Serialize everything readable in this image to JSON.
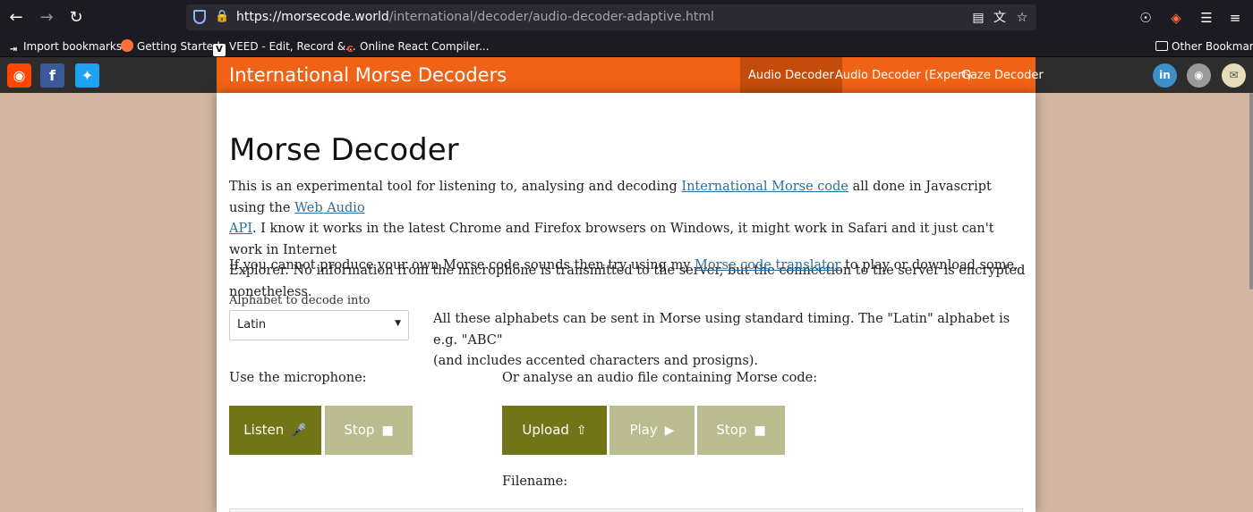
{
  "browser": {
    "url_host": "https://morsecode.world",
    "url_path": "/international/decoder/audio-decoder-adaptive.html",
    "bookmarks": [
      {
        "label": "Import bookmarks..."
      },
      {
        "label": "Getting Started"
      },
      {
        "label": "VEED - Edit, Record &..."
      },
      {
        "label": "Online React Compiler..."
      }
    ],
    "other_bookmarks": "Other Bookmarks",
    "icons": {
      "back": "arrow-left-icon",
      "forward": "arrow-right-icon",
      "reload": "reload-icon",
      "shield": "shield-icon",
      "lock": "lock-icon",
      "reader": "reader-view-icon",
      "translate": "translate-icon",
      "star": "star-icon",
      "pocket": "pocket-icon",
      "extension": "extensions-icon"
    }
  },
  "colors": {
    "accent": "#f06316",
    "accent_active": "#c44c0a",
    "button_dark": "#727517",
    "button_light": "#babb8e",
    "link": "#2c6e9e"
  },
  "site": {
    "title": "International Morse Decoders",
    "nav": [
      {
        "label": "Audio Decoder",
        "active": true
      },
      {
        "label": "Audio Decoder (Expert)",
        "active": false
      },
      {
        "label": "Gaze Decoder",
        "active": false
      }
    ],
    "social_left": [
      "reddit-icon",
      "facebook-icon",
      "twitter-icon"
    ],
    "social_right": [
      "linkedin-icon",
      "github-icon",
      "email-icon"
    ]
  },
  "main": {
    "heading": "Morse Decoder",
    "intro": {
      "t1": "This is an experimental tool for listening to, analysing and decoding ",
      "link1": "International Morse code",
      "t2": " all done in Javascript using the ",
      "link2a": "Web Audio",
      "link2b": "API",
      "t3": ". I know it works in the latest Chrome and Firefox browsers on Windows, it might work in Safari and it just can't work in Internet",
      "t4": "Explorer. No information from the microphone is transmitted to the server, but the connection to the server is encrypted nonetheless."
    },
    "translator": {
      "t1": "If you cannot produce your own Morse code sounds then try using my ",
      "link": "Morse code translator",
      "t2": " to play or download some."
    },
    "alphabet_label": "Alphabet to decode into",
    "alphabet_value": "Latin",
    "alphabet_note_1": "All these alphabets can be sent in Morse using standard timing. The \"Latin\" alphabet is e.g. \"ABC\"",
    "alphabet_note_2": "(and includes accented characters and prosigns).",
    "mic_label": "Use the microphone:",
    "file_label": "Or analyse an audio file containing Morse code:",
    "buttons": {
      "listen": "Listen",
      "stop_mic": "Stop",
      "upload": "Upload",
      "play": "Play",
      "stop_file": "Stop"
    },
    "filename_label": "Filename:"
  }
}
